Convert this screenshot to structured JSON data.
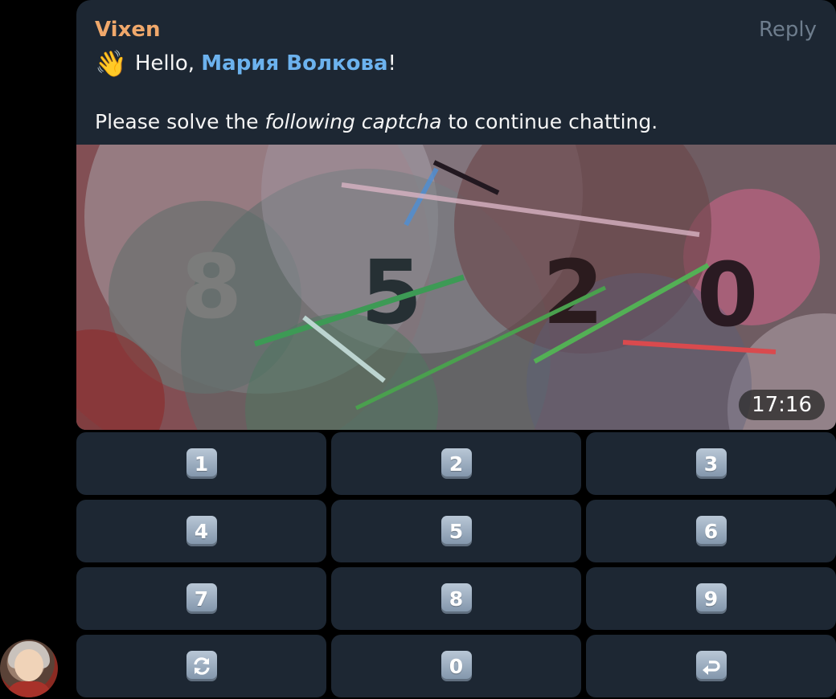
{
  "message": {
    "sender": "Vixen",
    "reply_label": "Reply",
    "greeting_emoji": "👋",
    "greeting_prefix": "Hello, ",
    "mention_name": "Мария Волкова",
    "greeting_suffix": "!",
    "instruction_before": "Please solve the ",
    "instruction_italic": "following captcha",
    "instruction_after": " to continue chatting.",
    "captcha_digits": [
      "8",
      "5",
      "2",
      "0"
    ],
    "time": "17:16"
  },
  "keyboard": {
    "rows": [
      [
        {
          "label": "1"
        },
        {
          "label": "2"
        },
        {
          "label": "3"
        }
      ],
      [
        {
          "label": "4"
        },
        {
          "label": "5"
        },
        {
          "label": "6"
        }
      ],
      [
        {
          "label": "7"
        },
        {
          "label": "8"
        },
        {
          "label": "9"
        }
      ],
      [
        {
          "label": "",
          "icon": "refresh-icon"
        },
        {
          "label": "0"
        },
        {
          "label": "",
          "icon": "backspace-return-icon"
        }
      ]
    ]
  },
  "colors": {
    "bubble_bg": "#1d2733",
    "sender": "#f0a86b",
    "mention": "#6cb2ee",
    "reply": "#6e7d8d"
  }
}
